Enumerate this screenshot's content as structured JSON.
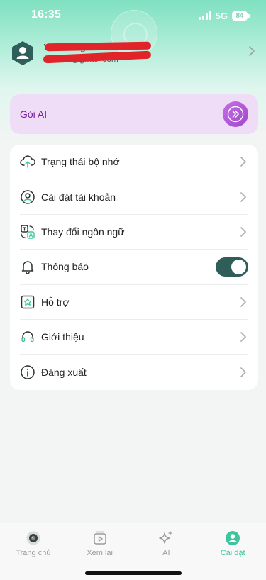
{
  "status_bar": {
    "time": "16:35",
    "network": "5G",
    "battery": "84"
  },
  "profile": {
    "name": "W...........gmail...",
    "email": "w.........@gmail.com"
  },
  "ai_card": {
    "label": "Gói AI"
  },
  "menu": {
    "items": [
      {
        "label": "Trạng thái bộ nhớ",
        "icon": "cloud-upload-icon"
      },
      {
        "label": "Cài đặt tài khoản",
        "icon": "user-circle-icon"
      },
      {
        "label": "Thay đổi ngôn ngữ",
        "icon": "translate-icon"
      },
      {
        "label": "Thông báo",
        "icon": "bell-icon",
        "toggle_on": true
      },
      {
        "label": "Hỗ trợ",
        "icon": "star-badge-icon"
      },
      {
        "label": "Giới thiệu",
        "icon": "headset-icon"
      },
      {
        "label": "Đăng xuất",
        "icon": "info-icon"
      }
    ]
  },
  "tabbar": {
    "tabs": [
      {
        "label": "Trang chủ",
        "icon": "camera-icon",
        "active": false
      },
      {
        "label": "Xem lại",
        "icon": "playback-icon",
        "active": false
      },
      {
        "label": "AI",
        "icon": "sparkle-icon",
        "active": false
      },
      {
        "label": "Cài đặt",
        "icon": "user-icon",
        "active": true
      }
    ]
  },
  "colors": {
    "accent": "#3fc59d",
    "dark_teal": "#2e5d5a",
    "ai_purple": "#7a1fa0",
    "ai_card_bg": "#efdcf6"
  }
}
